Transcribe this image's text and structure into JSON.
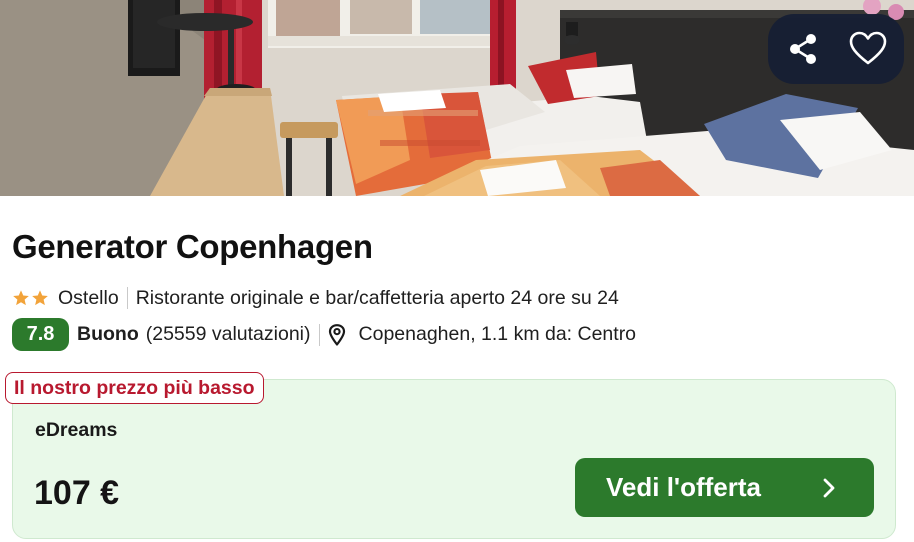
{
  "hero": {
    "share_icon": "share-icon",
    "favorite_icon": "heart-outline-icon"
  },
  "hotel": {
    "name": "Generator Copenhagen",
    "star_count": 2,
    "star_color": "#f2a33a",
    "type": "Ostello",
    "feature": "Ristorante originale e bar/caffetteria aperto 24 ore su 24",
    "score": "7.8",
    "score_label": "Buono",
    "reviews": "(25559 valutazioni)",
    "location_icon": "map-pin-icon",
    "location": "Copenaghen, 1.1 km da: Centro"
  },
  "deal": {
    "badge": "Il nostro prezzo più basso",
    "provider": "eDreams",
    "price": "107 €",
    "cta_label": "Vedi l'offerta",
    "cta_icon": "chevron-right-icon"
  },
  "colors": {
    "accent_green": "#2c7a2c",
    "deal_background": "#e9f9e9",
    "badge_red": "#b8192f",
    "action_pill": "#161e34"
  }
}
